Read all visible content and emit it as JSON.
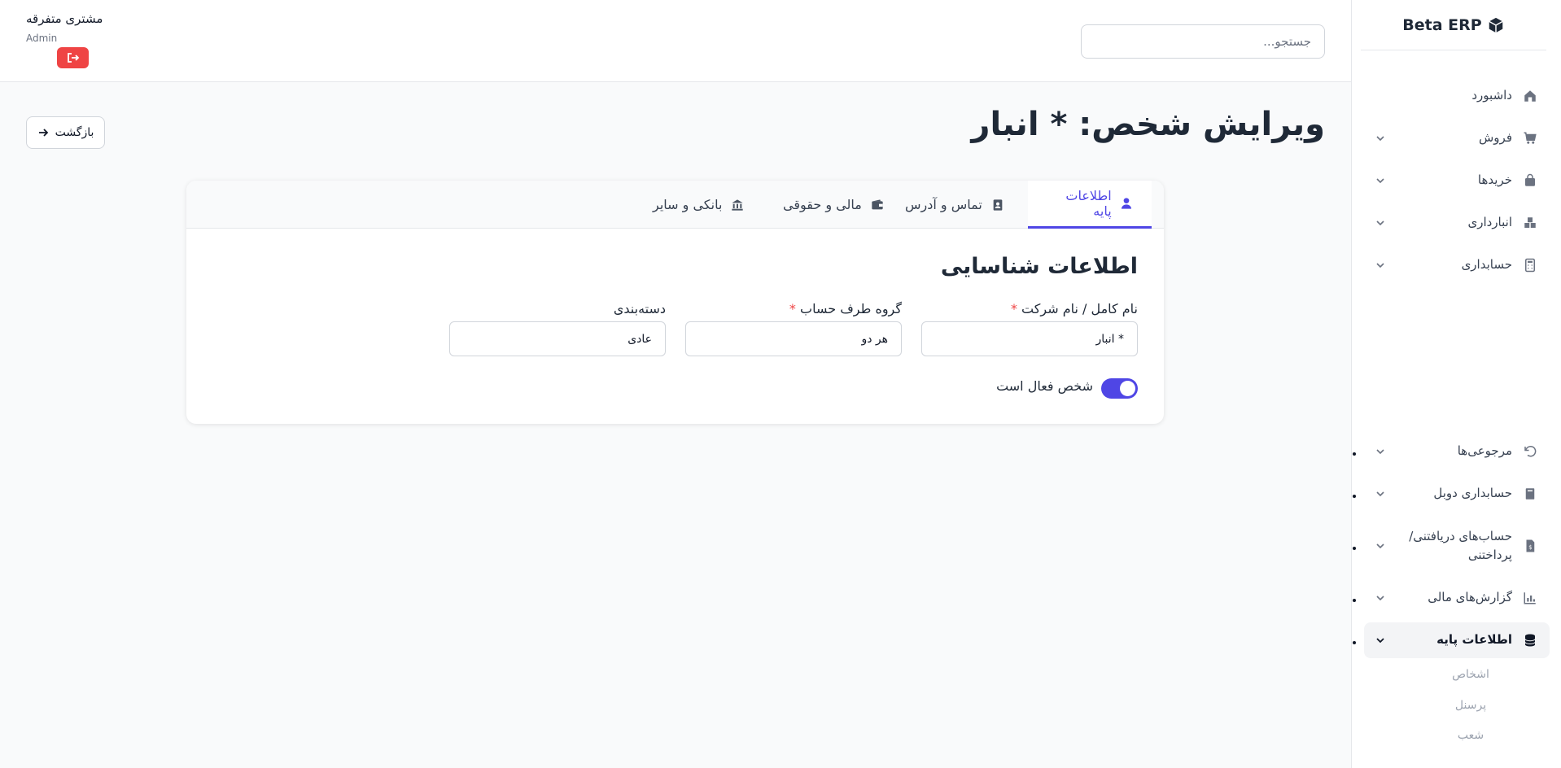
{
  "app": {
    "brand": "Beta ERP"
  },
  "search": {
    "placeholder": "جستجو..."
  },
  "user": {
    "name": "مشتری متفرقه",
    "role": "Admin"
  },
  "sidebar": {
    "items": [
      {
        "label": "داشبورد",
        "icon": "home-icon"
      },
      {
        "label": "فروش",
        "icon": "cart-icon"
      },
      {
        "label": "خریدها",
        "icon": "bag-icon"
      },
      {
        "label": "انبارداری",
        "icon": "warehouse-icon"
      },
      {
        "label": "حسابداری",
        "icon": "calculator-icon"
      },
      {
        "label": "مرجوعی‌ها",
        "icon": "undo-icon"
      },
      {
        "label": "حسابداری دوبل",
        "icon": "book-icon"
      },
      {
        "label": "حساب‌های دریافتنی/ پرداختنی",
        "icon": "invoice-icon"
      },
      {
        "label": "گزارش‌های مالی",
        "icon": "chart-icon"
      },
      {
        "label": "اطلاعات پایه",
        "icon": "database-icon"
      }
    ],
    "subitems": [
      "اشخاص",
      "پرسنل",
      "شعب"
    ]
  },
  "page": {
    "title": "ویرایش شخص: * انبار",
    "back_label": "بازگشت"
  },
  "tabs": [
    {
      "label": "اطلاعات پایه",
      "icon": "user-icon",
      "active": true
    },
    {
      "label": "تماس و آدرس",
      "icon": "contact-icon"
    },
    {
      "label": "مالی و حقوقی",
      "icon": "wallet-icon"
    },
    {
      "label": "بانکی و سایر",
      "icon": "bank-icon"
    }
  ],
  "form": {
    "section_title": "اطلاعات شناسایی",
    "fields": [
      {
        "label": "نام کامل / نام شرکت",
        "required": true,
        "value": "* انبار"
      },
      {
        "label": "گروه طرف حساب",
        "required": true,
        "value": "هر دو"
      },
      {
        "label": "دسته‌بندی",
        "required": false,
        "value": "عادی"
      }
    ],
    "required_mark": "*",
    "active_toggle": {
      "label": "شخص فعال است",
      "on": true
    }
  },
  "colors": {
    "accent": "#4f46e5",
    "danger": "#ef4444"
  }
}
